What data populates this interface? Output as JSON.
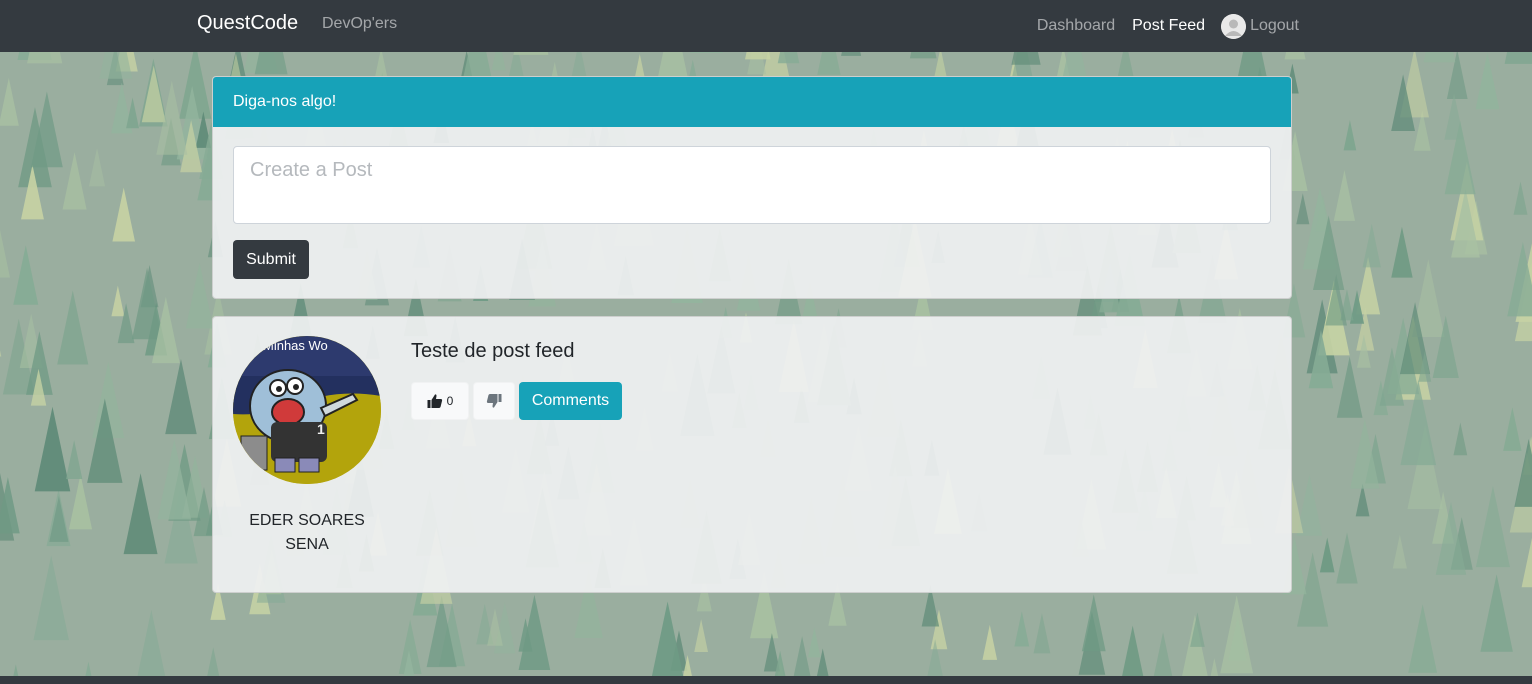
{
  "navbar": {
    "brand": "QuestCode",
    "left_link": "DevOp'ers",
    "links": [
      "Dashboard",
      "Post Feed"
    ],
    "logout": "Logout"
  },
  "post_form": {
    "header": "Diga-nos algo!",
    "placeholder": "Create a Post",
    "value": "",
    "submit_label": "Submit"
  },
  "feed": {
    "posts": [
      {
        "text": "Teste de post feed",
        "author_line1": "EDER SOARES",
        "author_line2": "SENA",
        "avatar_caption": "Minhas Wo",
        "likes": "0",
        "comments_label": "Comments"
      }
    ]
  },
  "colors": {
    "navbar": "#343a40",
    "accent": "#17a2b8",
    "dark_button": "#343a40"
  }
}
